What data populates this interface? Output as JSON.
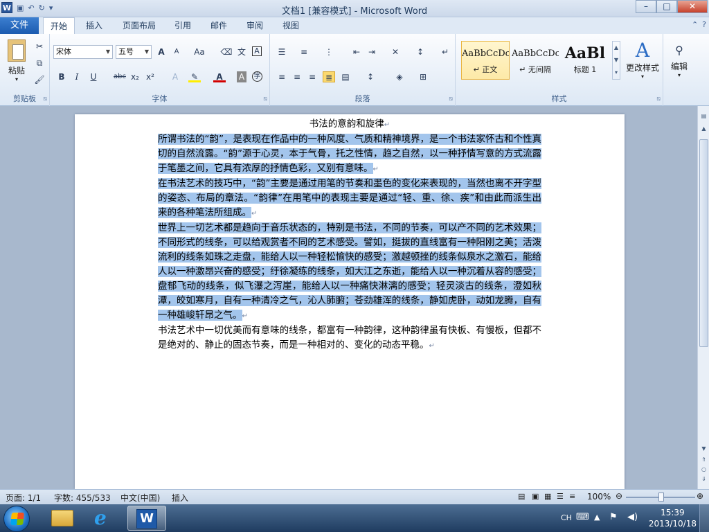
{
  "window": {
    "title": "文档1 [兼容模式] - Microsoft Word",
    "app_icon_letter": "W",
    "controls": {
      "minimize": "–",
      "maximize": "□",
      "close": "✕"
    }
  },
  "ribbon_tabs": [
    "文件",
    "开始",
    "插入",
    "页面布局",
    "引用",
    "邮件",
    "审阅",
    "视图"
  ],
  "active_tab": "开始",
  "ribbon": {
    "clipboard": {
      "label": "剪贴板",
      "paste": "粘贴"
    },
    "font": {
      "label": "字体",
      "font_name": "宋体",
      "font_size": "五号",
      "grow": "A",
      "shrink": "A",
      "change_case": "Aa",
      "bold": "B",
      "italic": "I",
      "underline": "U",
      "strike": "abc",
      "subscript": "x₂",
      "superscript": "x²",
      "font_color": "A"
    },
    "paragraph": {
      "label": "段落"
    },
    "styles": {
      "label": "样式",
      "items": [
        {
          "sample": "AaBbCcDc",
          "name": "↵ 正文",
          "selected": true
        },
        {
          "sample": "AaBbCcDc",
          "name": "↵ 无间隔",
          "selected": false
        },
        {
          "sample": "AaBl",
          "name": "标题 1",
          "selected": false
        }
      ],
      "change_styles": "更改样式"
    },
    "editing": {
      "label": "编辑"
    }
  },
  "document": {
    "title": "书法的意韵和旋律",
    "paragraphs": [
      {
        "text": "所谓书法的“韵”，是表现在作品中的一种风度、气质和精神境界，是一个书法家怀古和个性真切的自然流露。“韵”源于心灵，本于气骨，托之性情，趋之自然，以一种抒情写意的方式流露于笔墨之间，它具有浓厚的抒情色彩，又别有意味。",
        "selected": true
      },
      {
        "text": "在书法艺术的技巧中，“韵”主要是通过用笔的节奏和墨色的变化来表现的，当然也离不开字型的姿态、布局的章法。“韵律”在用笔中的表现主要是通过“轻、重、徐、疾”和由此而派生出来的各种笔法所组成。",
        "selected": true
      },
      {
        "text": "世界上一切艺术都是趋向于音乐状态的，特别是书法，不同的节奏，可以产不同的艺术效果；不同形式的线条，可以给观赏者不同的艺术感受。譬如，挺拔的直线富有一种阳刚之美；活泼流利的线条如珠之走盘，能给人以一种轻松愉快的感受；激越顿挫的线条似泉水之激石，能给人以一种激昂兴奋的感受；纡徐凝练的线条，如大江之东逝，能给人以一种沉着从容的感受；盘郁飞动的线条，似飞瀑之泻崖，能给人以一种痛快淋漓的感受；轻灵淡古的线条，澄如秋潭，皎如寒月，自有一种清冷之气，沁人肺腑；苍劲雄浑的线条，静如虎卧，动如龙腾，自有一种雄峻轩昂之气。",
        "selected": true
      },
      {
        "text": "书法艺术中一切优美而有意味的线条，都富有一种韵律，这种韵律虽有快板、有慢板，但都不是绝对的、静止的固态节奏，而是一种相对的、变化的动态平稳。",
        "selected": false
      }
    ],
    "para_mark": "↵"
  },
  "status": {
    "page": "页面: 1/1",
    "words": "字数: 455/533",
    "language": "中文(中国)",
    "mode": "插入",
    "zoom": "100%",
    "zoom_level": 1.0
  },
  "taskbar": {
    "ime": "CH",
    "time": "15:39",
    "date": "2013/10/18"
  },
  "colors": {
    "accent": "#2b579a",
    "selection": "#a3c5ec",
    "file_tab": "#1b5bb0"
  }
}
